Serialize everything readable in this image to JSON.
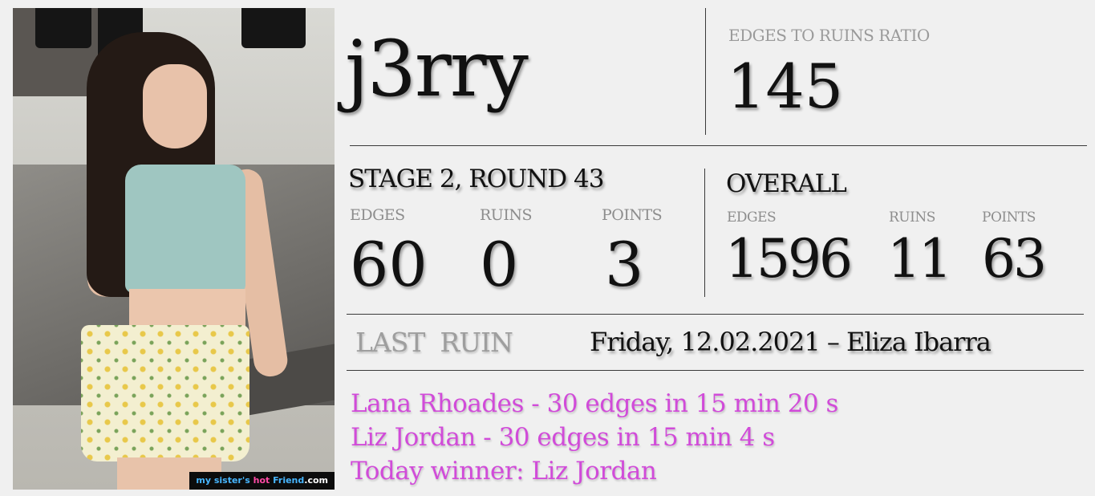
{
  "photo": {
    "watermark": {
      "prefix": "my sister's ",
      "highlight": "hot",
      "middle": " Friend",
      "suffix": ".com"
    }
  },
  "player": {
    "name": "j3rry"
  },
  "ratio": {
    "label": "EDGES TO RUINS RATIO",
    "value": "145"
  },
  "stage": {
    "title": "STAGE 2, ROUND 43",
    "labels": {
      "edges": "EDGES",
      "ruins": "RUINS",
      "points": "POINTS"
    },
    "values": {
      "edges": "60",
      "ruins": "0",
      "points": "3"
    }
  },
  "overall": {
    "title": "OVERALL",
    "labels": {
      "edges": "EDGES",
      "ruins": "RUINS",
      "points": "POINTS"
    },
    "values": {
      "edges": "1596",
      "ruins": "11",
      "points": "63"
    }
  },
  "last_ruin": {
    "label": "LAST  RUIN",
    "value": "Friday, 12.02.2021 – Eliza Ibarra"
  },
  "results": {
    "lines": [
      "Lana Rhoades - 30 edges in 15 min 20 s",
      "Liz Jordan - 30 edges in 15 min 4 s",
      "Today winner: Liz Jordan"
    ]
  },
  "colors": {
    "background": "#f0f0f0",
    "text": "#111111",
    "label": "#9a9a9a",
    "highlight": "#d14bd9"
  }
}
